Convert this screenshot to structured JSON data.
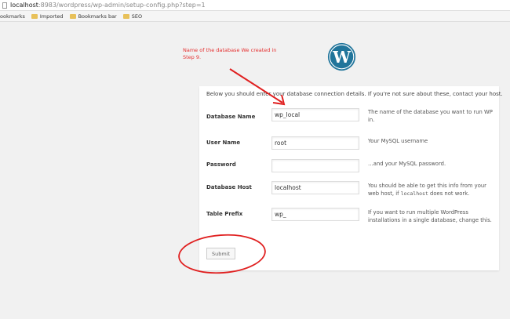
{
  "browser": {
    "url_host": "localhost",
    "url_rest": ":8983/wordpress/wp-admin/setup-config.php?step=1",
    "bookmarks": [
      "ookmarks",
      "Imported",
      "Bookmarks bar",
      "SEO"
    ]
  },
  "annotation": "Name of the database We created in Step 9.",
  "intro": "Below you should enter your database connection details. If you're not sure about these, contact your host.",
  "fields": [
    {
      "label": "Database Name",
      "value": "wp_local",
      "desc": "The name of the database you want to run WP in."
    },
    {
      "label": "User Name",
      "value": "root",
      "desc": "Your MySQL username"
    },
    {
      "label": "Password",
      "value": "",
      "desc": "…and your MySQL password."
    },
    {
      "label": "Database Host",
      "value": "localhost",
      "desc_a": "You should be able to get this info from your web host, if ",
      "desc_code": "localhost",
      "desc_b": " does not work."
    },
    {
      "label": "Table Prefix",
      "value": "wp_",
      "desc": "If you want to run multiple WordPress installations in a single database, change this."
    }
  ],
  "submit_label": "Submit",
  "colors": {
    "annotation": "#e02020",
    "wp_blue": "#21759b"
  }
}
